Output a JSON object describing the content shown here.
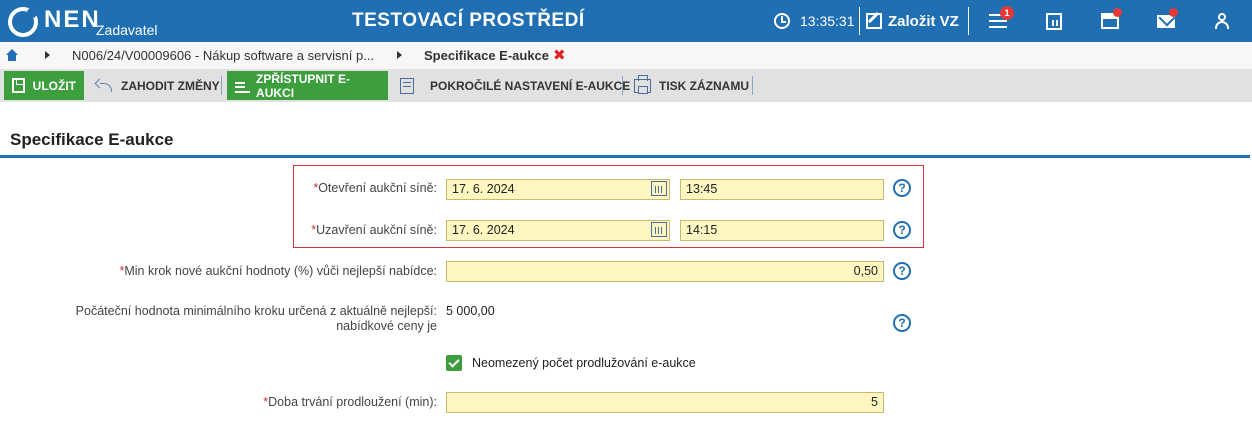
{
  "header": {
    "logo_text": "NEN",
    "logo_sub": "Zadavatel",
    "app_title": "TESTOVACÍ PROSTŘEDÍ",
    "time": "13:35:31",
    "create_label": "Založit VZ",
    "notif_count": "1",
    "accent_color": "#1f6fb2"
  },
  "breadcrumb": {
    "item1": "N006/24/V00009606 - Nákup software a servisní p...",
    "current": "Specifikace E-aukce",
    "close_symbol": "✖"
  },
  "toolbar": {
    "save_label": "ULOŽIT",
    "discard_label": "ZAHODIT ZMĚNY",
    "publish_label": "ZPŘÍSTUPNIT E-AUKCI",
    "advanced_label": "POKROČILÉ NASTAVENÍ E-AUKCE",
    "print_label": "TISK ZÁZNAMU"
  },
  "section": {
    "title": "Specifikace E-aukce"
  },
  "form": {
    "opening_label": "Otevření aukční síně:",
    "opening_date": "17. 6. 2024",
    "opening_time": "13:45",
    "closing_label": "Uzavření aukční síně:",
    "closing_date": "17. 6. 2024",
    "closing_time": "14:15",
    "minstep_label": "Min krok nové aukční hodnoty (%) vůči nejlepší nabídce:",
    "minstep_value": "0,50",
    "initial_label_line1": "Počáteční hodnota minimálního kroku určená z aktuálně nejlepší:",
    "initial_label_line2": "nabídkové ceny je",
    "initial_value": "5 000,00",
    "unlimited_label": "Neomezený počet prodlužování e-aukce",
    "extension_label": "Doba trvání prodloužení (min):",
    "extension_value": "5",
    "required_mark": "*",
    "help_symbol": "?"
  }
}
